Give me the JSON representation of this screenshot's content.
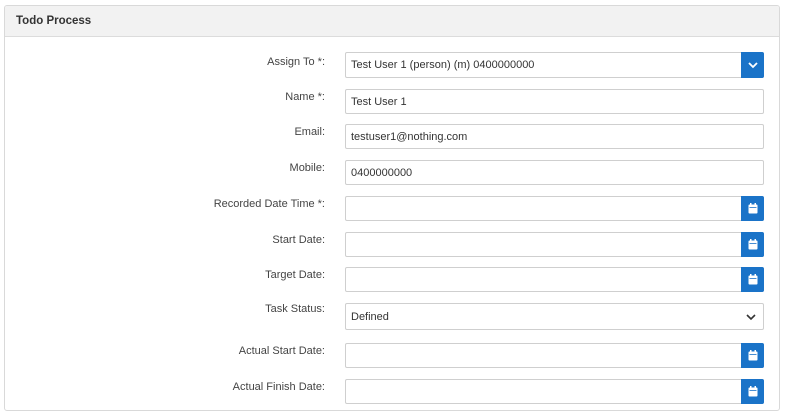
{
  "panel": {
    "title": "Todo Process"
  },
  "fields": {
    "assign_to": {
      "label": "Assign To *:",
      "value": "Test User 1 (person) (m) 0400000000",
      "icon": "chevron-down-icon"
    },
    "name": {
      "label": "Name *:",
      "value": "Test User 1"
    },
    "email": {
      "label": "Email:",
      "value": "testuser1@nothing.com"
    },
    "mobile": {
      "label": "Mobile:",
      "value": "0400000000"
    },
    "recorded_date_time": {
      "label": "Recorded Date Time *:",
      "value": "",
      "icon": "calendar-icon"
    },
    "start_date": {
      "label": "Start Date:",
      "value": "",
      "icon": "calendar-icon"
    },
    "target_date": {
      "label": "Target Date:",
      "value": "",
      "icon": "calendar-icon"
    },
    "task_status": {
      "label": "Task Status:",
      "value": "Defined",
      "icon": "chevron-down-icon"
    },
    "actual_start_date": {
      "label": "Actual Start Date:",
      "value": "",
      "icon": "calendar-icon"
    },
    "actual_finish_date": {
      "label": "Actual Finish Date:",
      "value": "",
      "icon": "calendar-icon"
    }
  },
  "colors": {
    "accent": "#1a73c8",
    "header_bg": "#f2f2f2",
    "border": "#cfcfcf"
  }
}
